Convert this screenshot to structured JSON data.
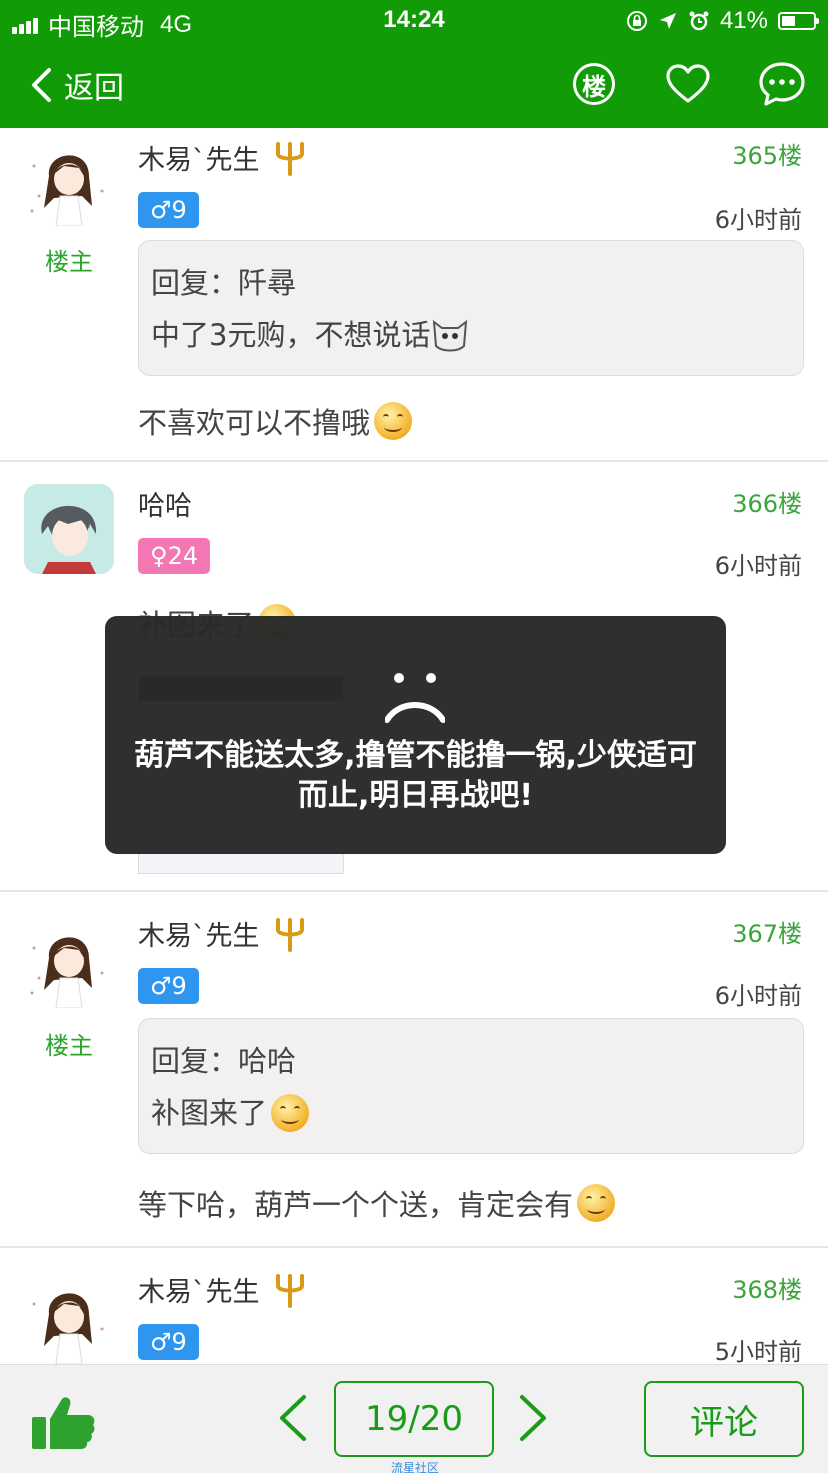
{
  "status": {
    "carrier": "中国移动",
    "network": "4G",
    "time": "14:24",
    "battery": "41%"
  },
  "nav": {
    "back_label": "返回",
    "floor_icon_char": "楼"
  },
  "posts": [
    {
      "user": "木易`先生",
      "floor": "365楼",
      "badge": "♂9",
      "time": "6小时前",
      "host_label": "楼主",
      "quote_line1": "回复：阡尋",
      "quote_line2": "中了3元购，不想说话",
      "text": "不喜欢可以不撸哦"
    },
    {
      "user": "哈哈",
      "floor": "366楼",
      "badge": "♀24",
      "time": "6小时前",
      "text": "补图来了"
    },
    {
      "user": "木易`先生",
      "floor": "367楼",
      "badge": "♂9",
      "time": "6小时前",
      "host_label": "楼主",
      "quote_line1": "回复：哈哈",
      "quote_line2": "补图来了",
      "text": "等下哈，葫芦一个个送，肯定会有"
    },
    {
      "user": "木易`先生",
      "floor": "368楼",
      "badge": "♂9",
      "time": "5小时前"
    }
  ],
  "toast": {
    "message": "葫芦不能送太多,撸管不能撸一锅,少侠适可而止,明日再战吧!"
  },
  "bottom": {
    "page": "19/20",
    "comment_label": "评论",
    "watermark": "流星社区"
  },
  "colors": {
    "brand_green": "#119b06",
    "male_badge": "#2f96ef",
    "female_badge": "#f277b3",
    "floor_green": "#3ba53b"
  }
}
